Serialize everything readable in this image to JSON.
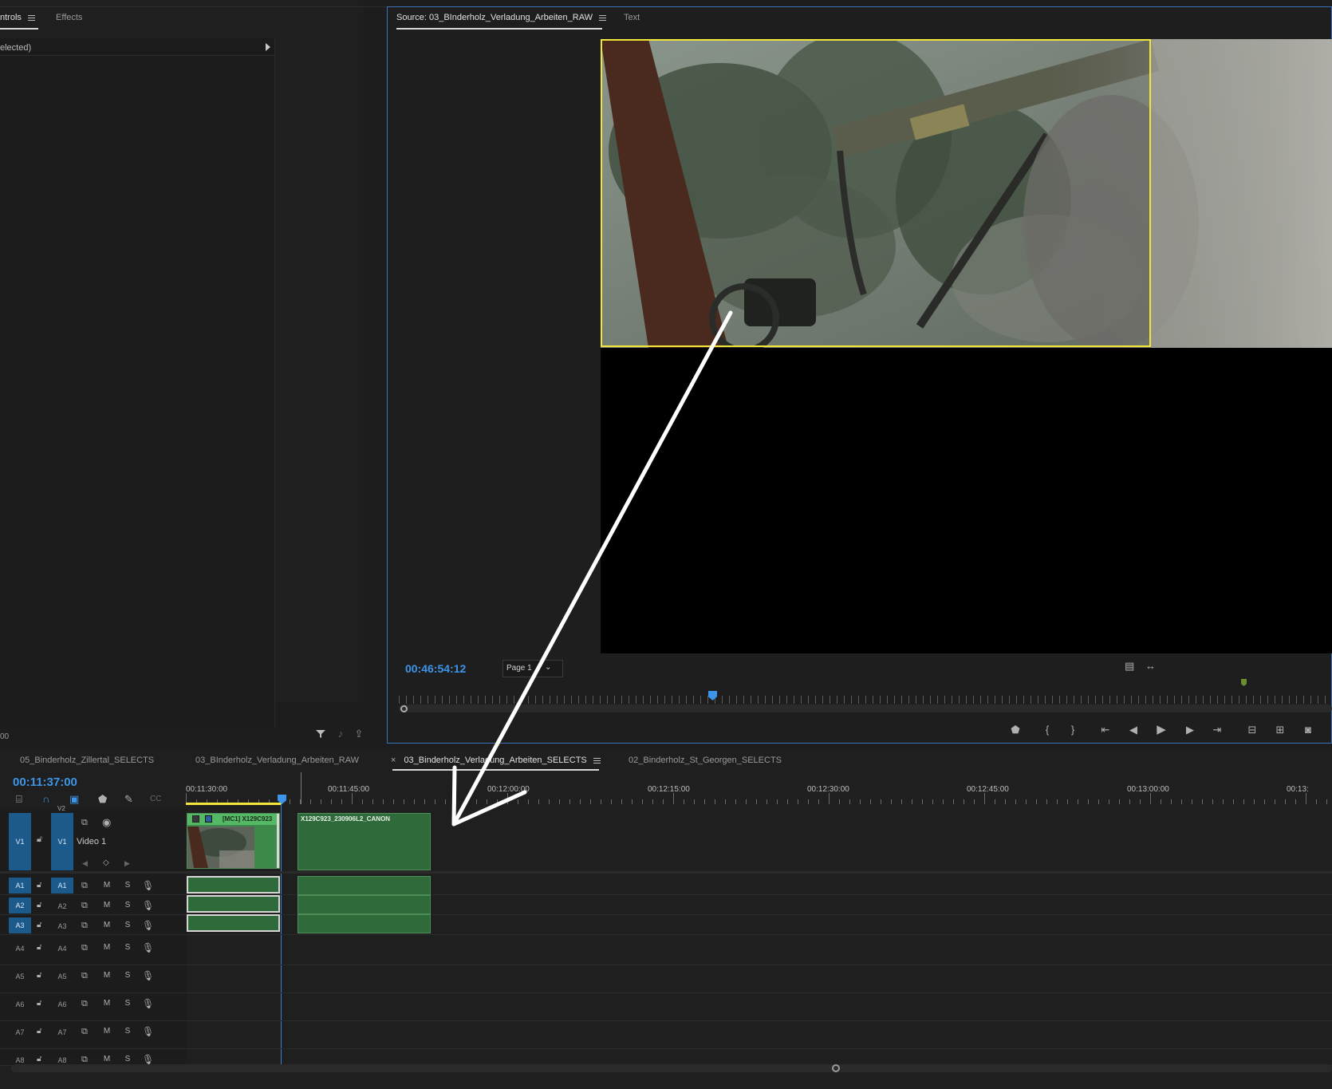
{
  "left_panel": {
    "tabs": [
      {
        "label": "ntrols",
        "active": true
      },
      {
        "label": "Effects",
        "active": false
      }
    ],
    "clip_row": "elected)",
    "bottom_timecode": "00"
  },
  "source_monitor": {
    "tabs": [
      {
        "label": "Source: 03_BInderholz_Verladung_Arbeiten_RAW",
        "active": true
      },
      {
        "label": "Text",
        "active": false
      }
    ],
    "timecode": "00:46:54:12",
    "page_select": "Page 1",
    "transport_icons": [
      "marker-icon",
      "mark-in-icon",
      "mark-out-icon",
      "go-to-in-icon",
      "step-back-icon",
      "play-icon",
      "step-forward-icon",
      "go-to-out-icon",
      "insert-icon",
      "overwrite-icon",
      "export-frame-icon"
    ]
  },
  "timeline": {
    "tabs": [
      {
        "label": "05_Binderholz_Zillertal_SELECTS",
        "active": false,
        "closable": false
      },
      {
        "label": "03_BInderholz_Verladung_Arbeiten_RAW",
        "active": false,
        "closable": false
      },
      {
        "label": "03_Binderholz_Verladung_Arbeiten_SELECTS",
        "active": true,
        "closable": true
      },
      {
        "label": "02_Binderholz_St_Georgen_SELECTS",
        "active": false,
        "closable": false
      }
    ],
    "close_glyph": "×",
    "timecode": "00:11:37:00",
    "ruler_labels": [
      "00:11:30:00",
      "00:11:45:00",
      "00:12:00:00",
      "00:12:15:00",
      "00:12:30:00",
      "00:12:45:00",
      "00:13:00:00",
      "00:13:"
    ],
    "video_track": {
      "src": "V1",
      "target": "V1",
      "name": "Video 1",
      "above": "V2"
    },
    "audio_tracks": [
      {
        "src": "A1",
        "target": "A1",
        "active": true
      },
      {
        "src": "A2",
        "target": "A2",
        "active": true
      },
      {
        "src": "A3",
        "target": "A3",
        "active": true
      },
      {
        "src": "A4",
        "target": "A4",
        "active": false
      },
      {
        "src": "A5",
        "target": "A5",
        "active": false
      },
      {
        "src": "A6",
        "target": "A6",
        "active": false
      },
      {
        "src": "A7",
        "target": "A7",
        "active": false
      },
      {
        "src": "A8",
        "target": "A8",
        "active": false
      }
    ],
    "mute_label": "M",
    "solo_label": "S",
    "clips": {
      "clip1_label": "[MC1] X129C923",
      "clip2_label": "X129C923_230906L2_CANON"
    }
  },
  "colors": {
    "accent_blue": "#3c95e8",
    "track_blue": "#1c5a8c",
    "clip_green": "#2f6b3a",
    "selection_yellow": "#f2e63a"
  }
}
